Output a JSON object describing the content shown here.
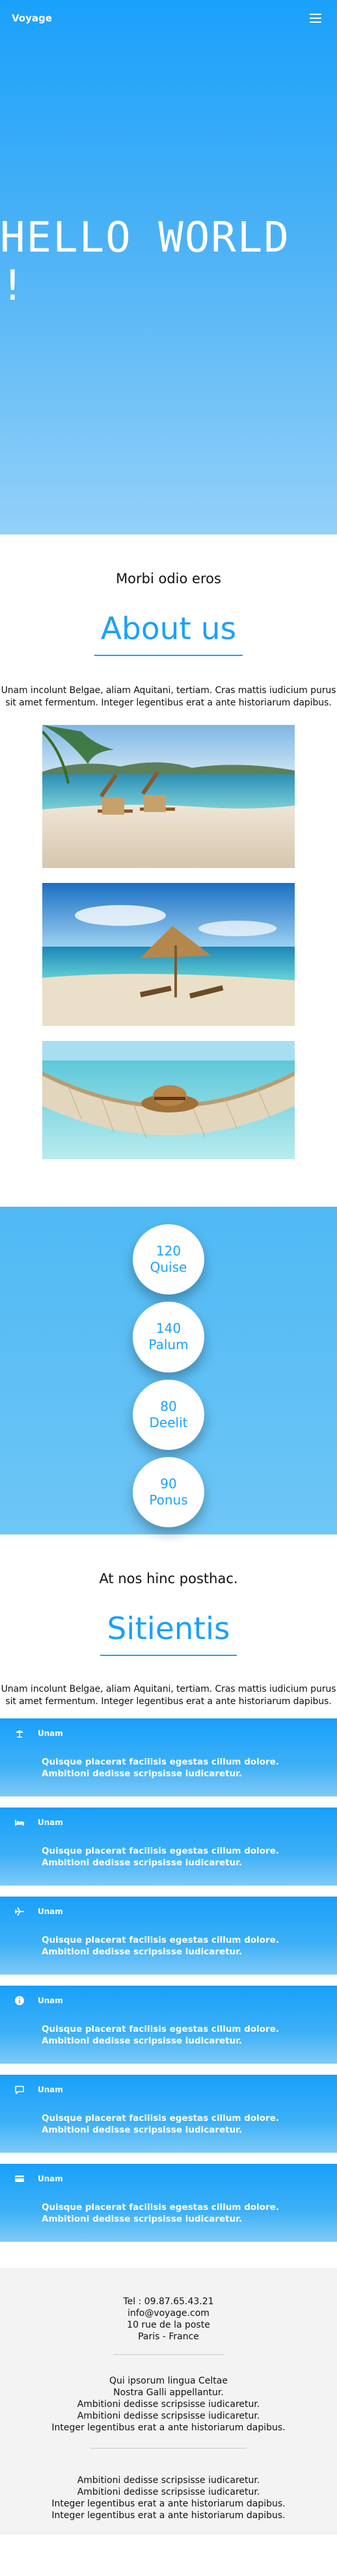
{
  "header": {
    "brand": "Voyage"
  },
  "hero": {
    "title": "HELLO WORLD !"
  },
  "about": {
    "kicker": "Morbi odio eros",
    "heading": "About us",
    "intro": "Unam incolunt Belgae, aliam Aquitani, tertiam. Cras mattis iudicium purus sit amet fermentum. Integer legentibus erat a ante historiarum dapibus."
  },
  "stats": [
    {
      "value": "120",
      "label": "Quise"
    },
    {
      "value": "140",
      "label": "Palum"
    },
    {
      "value": "80",
      "label": "Deelit"
    },
    {
      "value": "90",
      "label": "Ponus"
    }
  ],
  "services_section": {
    "kicker": "At nos hinc posthac.",
    "heading": "Sitientis",
    "intro": "Unam incolunt Belgae, aliam Aquitani, tertiam. Cras mattis iudicium purus sit amet fermentum. Integer legentibus erat a ante historiarum dapibus."
  },
  "services": [
    {
      "icon": "beach-umbrella-icon",
      "title": "Unam",
      "text": "Quisque placerat facilisis egestas cillum dolore. Ambitioni dedisse scripsisse iudicaretur."
    },
    {
      "icon": "bed-icon",
      "title": "Unam",
      "text": "Quisque placerat facilisis egestas cillum dolore. Ambitioni dedisse scripsisse iudicaretur."
    },
    {
      "icon": "airplane-icon",
      "title": "Unam",
      "text": "Quisque placerat facilisis egestas cillum dolore. Ambitioni dedisse scripsisse iudicaretur."
    },
    {
      "icon": "info-icon",
      "title": "Unam",
      "text": "Quisque placerat facilisis egestas cillum dolore. Ambitioni dedisse scripsisse iudicaretur."
    },
    {
      "icon": "chat-bubble-icon",
      "title": "Unam",
      "text": "Quisque placerat facilisis egestas cillum dolore. Ambitioni dedisse scripsisse iudicaretur."
    },
    {
      "icon": "credit-card-icon",
      "title": "Unam",
      "text": "Quisque placerat facilisis egestas cillum dolore. Ambitioni dedisse scripsisse iudicaretur."
    }
  ],
  "footer": {
    "phone": "Tel : 09.87.65.43.21",
    "email": "info@voyage.com",
    "street": "10 rue de la poste",
    "city": "Paris - France",
    "block2": [
      "Qui ipsorum lingua Celtae",
      "Nostra Galli appellantur.",
      "Ambitioni dedisse scripsisse iudicaretur.",
      "Ambitioni dedisse scripsisse iudicaretur.",
      "Integer legentibus erat a ante historiarum dapibus."
    ],
    "block3": [
      "Ambitioni dedisse scripsisse iudicaretur.",
      "Ambitioni dedisse scripsisse iudicaretur.",
      "Integer legentibus erat a ante historiarum dapibus.",
      "Integer legentibus erat a ante historiarum dapibus."
    ]
  },
  "colors": {
    "accent": "#1aa1fb",
    "hero_bottom": "#93d1f8",
    "footer_bg": "#f3f3f3"
  }
}
